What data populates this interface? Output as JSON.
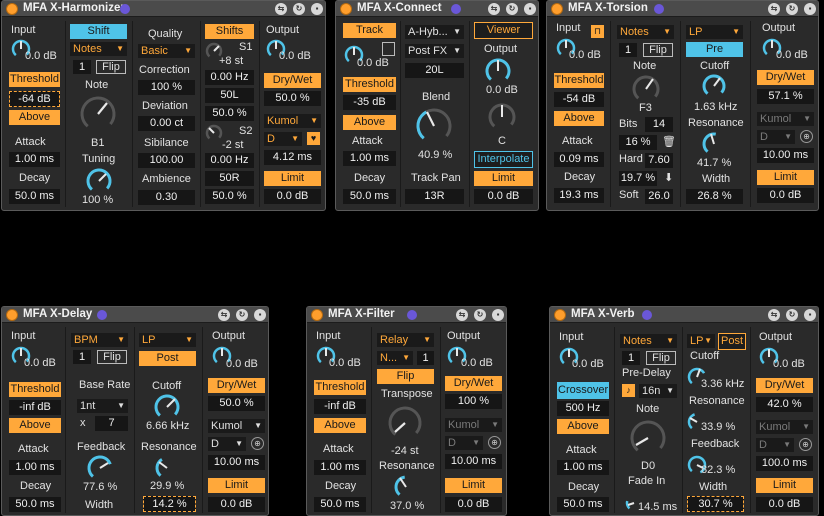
{
  "devices": {
    "harmonizer": {
      "title": "MFA X-Harmonizer",
      "input_label": "Input",
      "input_value": "0.0 dB",
      "threshold_label": "Threshold",
      "threshold_value": "-64 dB",
      "above_label": "Above",
      "attack_label": "Attack",
      "attack_value": "1.00 ms",
      "decay_label": "Decay",
      "decay_value": "50.0 ms",
      "shift_label": "Shift",
      "mode_select": "Notes",
      "voice_number": "1",
      "flip_label": "Flip",
      "note_label": "Note",
      "note_value": "B1",
      "tuning_label": "Tuning",
      "tuning_value": "100 %",
      "quality_label": "Quality",
      "quality_select": "Basic",
      "correction_label": "Correction",
      "correction_value": "100 %",
      "deviation_label": "Deviation",
      "deviation_value": "0.00 ct",
      "sibilance_label": "Sibilance",
      "sibilance_value": "100.00",
      "ambience_label": "Ambience",
      "ambience_value": "0.30",
      "shifts_label": "Shifts",
      "s1_label": "S1",
      "s1_shift": "+8 st",
      "s1_hz": "0.00 Hz",
      "s1_pan": "50L",
      "s1_mix": "50.0 %",
      "s2_label": "S2",
      "s2_shift": "-2 st",
      "s2_hz": "0.00 Hz",
      "s2_pan": "50R",
      "s2_mix": "50.0 %",
      "output_label": "Output",
      "output_value": "0.0 dB",
      "drywet_label": "Dry/Wet",
      "drywet_value": "50.0 %",
      "dither_select": "Kumol",
      "dither_sub": "D",
      "latency_value": "4.12 ms",
      "limit_label": "Limit",
      "limit_value": "0.0 dB"
    },
    "connect": {
      "title": "MFA X-Connect",
      "track_label": "Track",
      "input_value": "0.0 dB",
      "threshold_label": "Threshold",
      "threshold_value": "-35 dB",
      "above_label": "Above",
      "attack_label": "Attack",
      "attack_value": "1.00 ms",
      "decay_label": "Decay",
      "decay_value": "50.0 ms",
      "source_select": "A-Hyb...",
      "fx_select": "Post FX",
      "channel_value": "20L",
      "blend_label": "Blend",
      "blend_value": "40.9 %",
      "trackpan_label": "Track Pan",
      "trackpan_value": "13R",
      "viewer_label": "Viewer",
      "output_label": "Output",
      "output_value": "0.0 dB",
      "pan_value": "C",
      "interpolate_label": "Interpolate",
      "limit_label": "Limit",
      "limit_value": "0.0 dB"
    },
    "torsion": {
      "title": "MFA X-Torsion",
      "input_label": "Input",
      "input_value": "0.0 dB",
      "threshold_label": "Threshold",
      "threshold_value": "-54 dB",
      "above_label": "Above",
      "attack_label": "Attack",
      "attack_value": "0.09 ms",
      "decay_label": "Decay",
      "decay_value": "19.3 ms",
      "mode_select": "Notes",
      "voice_number": "1",
      "flip_label": "Flip",
      "note_label": "Note",
      "note_value": "F3",
      "bits_label": "Bits",
      "bits_value": "14",
      "mix_value": "16 %",
      "hard_label": "Hard",
      "hard_value": "7.60",
      "drive_value": "19.7 %",
      "soft_label": "Soft",
      "soft_value": "26.0",
      "filter_select": "LP",
      "pre_label": "Pre",
      "cutoff_label": "Cutoff",
      "cutoff_value": "1.63 kHz",
      "resonance_label": "Resonance",
      "resonance_value": "41.7 %",
      "width_label": "Width",
      "width_value": "26.8 %",
      "output_label": "Output",
      "output_value": "0.0 dB",
      "drywet_label": "Dry/Wet",
      "drywet_value": "57.1 %",
      "dither_select": "Kumol",
      "dither_sub": "D",
      "latency_value": "10.00 ms",
      "limit_label": "Limit",
      "limit_value": "0.0 dB"
    },
    "delay": {
      "title": "MFA X-Delay",
      "input_label": "Input",
      "input_value": "0.0 dB",
      "threshold_label": "Threshold",
      "threshold_value": "-inf dB",
      "above_label": "Above",
      "attack_label": "Attack",
      "attack_value": "1.00 ms",
      "decay_label": "Decay",
      "decay_value": "50.0 ms",
      "sync_select": "BPM",
      "voice_number": "1",
      "flip_label": "Flip",
      "baserate_label": "Base Rate",
      "rate_select": "1nt",
      "mult_label": "x",
      "mult_value": "7",
      "feedback_label": "Feedback",
      "feedback_value": "77.6 %",
      "width_label": "Width",
      "filter_select": "LP",
      "post_label": "Post",
      "cutoff_label": "Cutoff",
      "cutoff_value": "6.66 kHz",
      "resonance_label": "Resonance",
      "resonance_value": "29.9 %",
      "width_value": "14.2 %",
      "output_label": "Output",
      "output_value": "0.0 dB",
      "drywet_label": "Dry/Wet",
      "drywet_value": "50.0 %",
      "dither_select": "Kumol",
      "dither_sub": "D",
      "latency_value": "10.00 ms",
      "limit_label": "Limit",
      "limit_value": "0.0 dB"
    },
    "filter": {
      "title": "MFA X-Filter",
      "input_label": "Input",
      "input_value": "0.0 dB",
      "threshold_label": "Threshold",
      "threshold_value": "-inf dB",
      "above_label": "Above",
      "attack_label": "Attack",
      "attack_value": "1.00 ms",
      "decay_label": "Decay",
      "decay_value": "50.0 ms",
      "mode_select": "Relay",
      "sub_select": "N...",
      "voice_number": "1",
      "flip_label": "Flip",
      "transpose_label": "Transpose",
      "transpose_value": "-24 st",
      "resonance_label": "Resonance",
      "resonance_value": "37.0 %",
      "output_label": "Output",
      "output_value": "0.0 dB",
      "drywet_label": "Dry/Wet",
      "drywet_value": "100 %",
      "dither_select": "Kumol",
      "dither_sub": "D",
      "latency_value": "10.00 ms",
      "limit_label": "Limit",
      "limit_value": "0.0 dB"
    },
    "verb": {
      "title": "MFA X-Verb",
      "input_label": "Input",
      "input_value": "0.0 dB",
      "crossover_label": "Crossover",
      "crossover_value": "500 Hz",
      "above_label": "Above",
      "attack_label": "Attack",
      "attack_value": "1.00 ms",
      "decay_label": "Decay",
      "decay_value": "50.0 ms",
      "mode_select": "Notes",
      "voice_number": "1",
      "flip_label": "Flip",
      "predelay_label": "Pre-Delay",
      "predelay_select": "16n",
      "note_label": "Note",
      "note_value": "D0",
      "fadein_label": "Fade In",
      "fadein_value": "14.5 ms",
      "filter_select": "LP",
      "post_label": "Post",
      "cutoff_label": "Cutoff",
      "cutoff_value": "3.36 kHz",
      "resonance_label": "Resonance",
      "resonance_value": "33.9 %",
      "feedback_label": "Feedback",
      "feedback_value": "82.3 %",
      "width_label": "Width",
      "width_value": "30.7 %",
      "output_label": "Output",
      "output_value": "0.0 dB",
      "drywet_label": "Dry/Wet",
      "drywet_value": "42.0 %",
      "dither_select": "Kumol",
      "dither_sub": "D",
      "latency_value": "100.0 ms",
      "limit_label": "Limit",
      "limit_value": "0.0 dB"
    }
  },
  "colors": {
    "accent_orange": "#ffa83a",
    "accent_blue": "#4fc3e8",
    "knob_arc": "#4fc3e8",
    "panel": "#2a2a2a",
    "titlebar": "#4b4b4b",
    "mfa_dot": "#6a57d8"
  },
  "icons": [
    "power-icon",
    "fold-icon",
    "refresh-icon",
    "save-icon",
    "globe-icon",
    "trash-icon",
    "down-arrow-icon",
    "note-icon",
    "tuner-icon"
  ]
}
